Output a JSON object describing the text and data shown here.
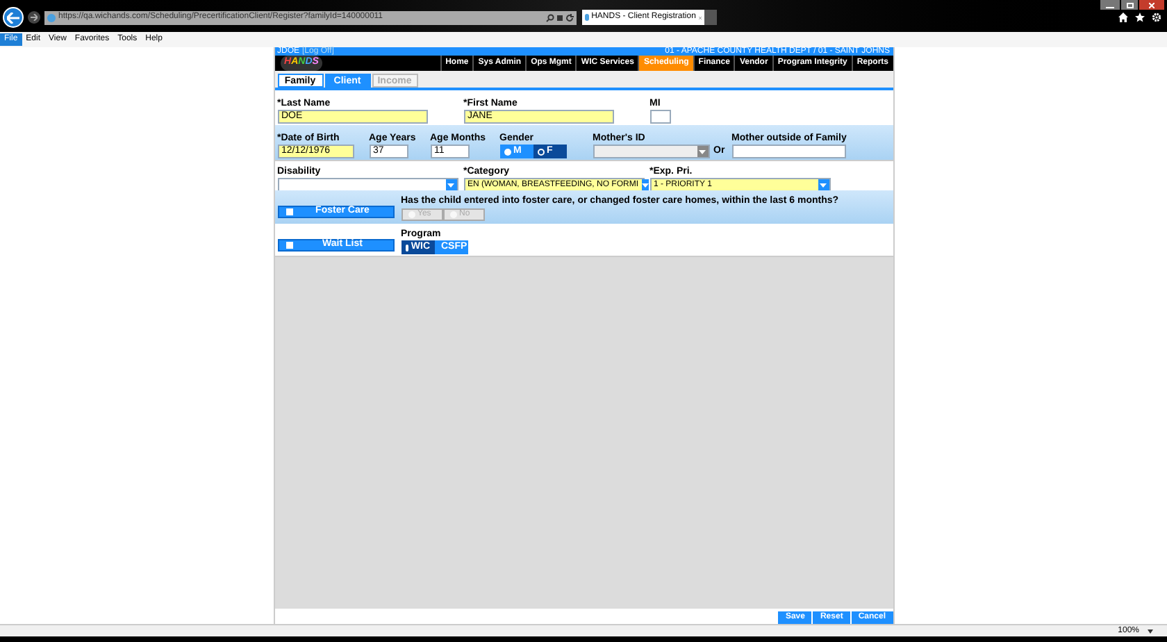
{
  "browser": {
    "url": "https://qa.wichands.com/Scheduling/PrecertificationClient/Register?familyId=140000011",
    "tab_title": "HANDS - Client Registration",
    "menu": [
      {
        "label": "File",
        "selected": true
      },
      {
        "label": "Edit",
        "selected": false
      },
      {
        "label": "View",
        "selected": false
      },
      {
        "label": "Favorites",
        "selected": false
      },
      {
        "label": "Tools",
        "selected": false
      },
      {
        "label": "Help",
        "selected": false
      }
    ],
    "zoom": "100%"
  },
  "header": {
    "user": "JDOE",
    "logoff": "[Log Off]",
    "agency": "01 - APACHE COUNTY HEALTH DEPT / 01 - SAINT JOHNS",
    "logo": "HANDS"
  },
  "nav": [
    {
      "label": "Home",
      "selected": false
    },
    {
      "label": "Sys Admin",
      "selected": false
    },
    {
      "label": "Ops Mgmt",
      "selected": false
    },
    {
      "label": "WIC Services",
      "selected": false
    },
    {
      "label": "Scheduling",
      "selected": true
    },
    {
      "label": "Finance",
      "selected": false
    },
    {
      "label": "Vendor",
      "selected": false
    },
    {
      "label": "Program Integrity",
      "selected": false
    },
    {
      "label": "Reports",
      "selected": false
    }
  ],
  "tabs": [
    {
      "label": "Family",
      "selected": false,
      "disabled": false
    },
    {
      "label": "Client",
      "selected": true,
      "disabled": false
    },
    {
      "label": "Income",
      "selected": false,
      "disabled": true
    }
  ],
  "form": {
    "last_name": {
      "label": "*Last Name",
      "value": "DOE"
    },
    "first_name": {
      "label": "*First Name",
      "value": "JANE"
    },
    "mi": {
      "label": "MI"
    },
    "dob": {
      "label": "*Date of Birth",
      "value": "12/12/1976"
    },
    "age_years": {
      "label": "Age Years",
      "value": "37"
    },
    "age_months": {
      "label": "Age Months",
      "value": "11"
    },
    "gender": {
      "label": "Gender",
      "options": [
        {
          "label": "M",
          "selected": false
        },
        {
          "label": "F",
          "selected": true
        }
      ]
    },
    "mothers_id": {
      "label": "Mother's ID"
    },
    "or": "Or",
    "mother_outside": {
      "label": "Mother outside of Family"
    },
    "disability": {
      "label": "Disability"
    },
    "category": {
      "label": "*Category",
      "value": "EN (WOMAN, BREASTFEEDING, NO FORMI"
    },
    "exp_pri": {
      "label": "*Exp. Pri.",
      "value": "1 - PRIORITY 1"
    },
    "foster_care": {
      "label": "Foster Care",
      "checked": false
    },
    "foster_question": "Has the child entered into foster care, or changed foster care homes, within the last 6 months?",
    "foster_answers": [
      {
        "label": "Yes",
        "selected": false,
        "disabled": true
      },
      {
        "label": "No",
        "selected": false,
        "disabled": true
      }
    ],
    "wait_list": {
      "label": "Wait List",
      "checked": false
    },
    "program": {
      "label": "Program",
      "options": [
        {
          "label": "WIC",
          "selected": true
        },
        {
          "label": "CSFP",
          "selected": false
        }
      ]
    }
  },
  "actions": [
    "Save",
    "Reset",
    "Cancel"
  ]
}
